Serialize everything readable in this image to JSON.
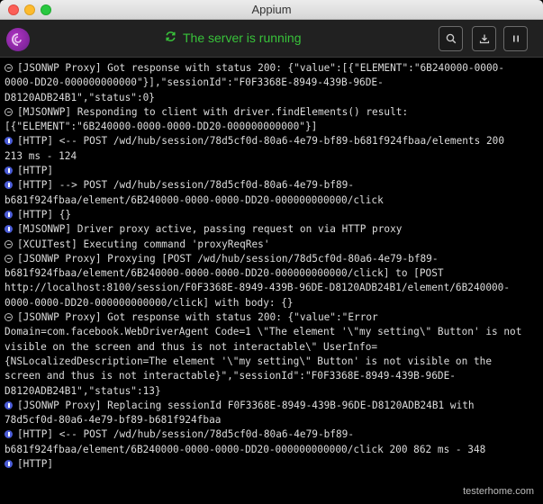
{
  "window": {
    "title": "Appium"
  },
  "header": {
    "status_text": "The server is running",
    "status_color": "#38c23a",
    "status_icon": "refresh-icon",
    "buttons": [
      {
        "name": "search-button",
        "icon": "search-icon"
      },
      {
        "name": "download-logs-button",
        "icon": "download-icon"
      },
      {
        "name": "pause-button",
        "icon": "pause-icon"
      }
    ]
  },
  "log": {
    "entries": [
      {
        "icon": "message-icon",
        "lines": [
          "[JSONWP Proxy] Got response with status 200: {\"value\":[{\"ELEMENT\":\"6B240000-0000-",
          "0000-DD20-000000000000\"}],\"sessionId\":\"F0F3368E-8949-439B-96DE-",
          "D8120ADB24B1\",\"status\":0}"
        ]
      },
      {
        "icon": "message-icon",
        "lines": [
          "[MJSONWP] Responding to client with driver.findElements() result:",
          "[{\"ELEMENT\":\"6B240000-0000-0000-DD20-000000000000\"}]"
        ]
      },
      {
        "icon": "info-icon",
        "lines": [
          "[HTTP] <-- POST /wd/hub/session/78d5cf0d-80a6-4e79-bf89-b681f924fbaa/elements 200",
          "213 ms - 124"
        ]
      },
      {
        "icon": "info-icon",
        "lines": [
          "[HTTP]"
        ]
      },
      {
        "icon": "info-icon",
        "lines": [
          "[HTTP] --> POST /wd/hub/session/78d5cf0d-80a6-4e79-bf89-",
          "b681f924fbaa/element/6B240000-0000-0000-DD20-000000000000/click"
        ]
      },
      {
        "icon": "info-icon",
        "lines": [
          "[HTTP] {}"
        ]
      },
      {
        "icon": "info-icon",
        "lines": [
          "[MJSONWP] Driver proxy active, passing request on via HTTP proxy"
        ]
      },
      {
        "icon": "message-icon",
        "lines": [
          "[XCUITest] Executing command 'proxyReqRes'"
        ]
      },
      {
        "icon": "message-icon",
        "lines": [
          "[JSONWP Proxy] Proxying [POST /wd/hub/session/78d5cf0d-80a6-4e79-bf89-",
          "b681f924fbaa/element/6B240000-0000-0000-DD20-000000000000/click] to [POST",
          "http://localhost:8100/session/F0F3368E-8949-439B-96DE-D8120ADB24B1/element/6B240000-",
          "0000-0000-DD20-000000000000/click] with body: {}"
        ]
      },
      {
        "icon": "message-icon",
        "lines": [
          "[JSONWP Proxy] Got response with status 200: {\"value\":\"Error",
          "Domain=com.facebook.WebDriverAgent Code=1 \\\"The element '\\\"my setting\\\" Button' is not",
          "visible on the screen and thus is not interactable\\\" UserInfo=",
          "{NSLocalizedDescription=The element '\\\"my setting\\\" Button' is not visible on the",
          "screen and thus is not interactable}\",\"sessionId\":\"F0F3368E-8949-439B-96DE-",
          "D8120ADB24B1\",\"status\":13}"
        ]
      },
      {
        "icon": "info-icon",
        "lines": [
          "[JSONWP Proxy] Replacing sessionId F0F3368E-8949-439B-96DE-D8120ADB24B1 with",
          "78d5cf0d-80a6-4e79-bf89-b681f924fbaa"
        ]
      },
      {
        "icon": "info-icon",
        "lines": [
          "[HTTP] <-- POST /wd/hub/session/78d5cf0d-80a6-4e79-bf89-",
          "b681f924fbaa/element/6B240000-0000-0000-DD20-000000000000/click 200 862 ms - 348"
        ]
      },
      {
        "icon": "info-icon",
        "lines": [
          "[HTTP]"
        ]
      }
    ]
  },
  "watermark": "testerhome.com"
}
